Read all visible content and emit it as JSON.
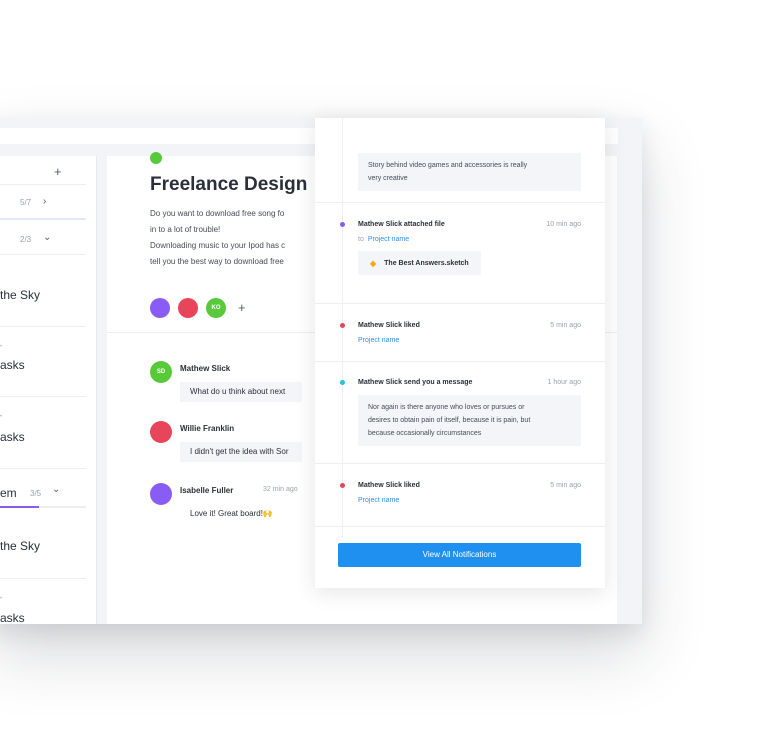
{
  "colors": {
    "accent_blue": "#1f90ef",
    "link_blue": "#2e8ff0",
    "purple": "#8a5cf6",
    "green": "#58c93a",
    "red": "#e8445a",
    "cyan": "#21c3d9"
  },
  "sidebar": {
    "add_icon": "plus-icon",
    "rows": [
      {
        "count": "5/7",
        "chevron": "chevron-right-icon"
      },
      {
        "count": "2/3",
        "chevron": "chevron-down-icon"
      }
    ],
    "items": [
      {
        "title": "the Sky"
      },
      {
        "title": "asks"
      },
      {
        "title": "asks"
      },
      {
        "title": "em",
        "count": "3/5",
        "chevron": "chevron-down-icon",
        "progress": 0.45
      },
      {
        "title": "the Sky"
      },
      {
        "title": "asks"
      }
    ]
  },
  "main": {
    "title": "Freelance Design",
    "description": [
      "Do you want to download free song fo",
      "in to a lot of trouble!",
      "Downloading music to your Ipod has c",
      "tell you the best way to download free"
    ],
    "avatars": [
      {
        "initials": "",
        "color": "#8a5cf6"
      },
      {
        "initials": "",
        "color": "#e8445a"
      },
      {
        "initials": "KO",
        "color": "#58c93a"
      }
    ],
    "messages": [
      {
        "name": "Mathew Slick",
        "time": "",
        "text": "What do u think about next",
        "initials": "SD",
        "color": "#58c93a"
      },
      {
        "name": "Willie Franklin",
        "time": "",
        "text": "I didn't get the idea with Sor",
        "initials": "",
        "color": "#e8445a"
      },
      {
        "name": "Isabelle Fuller",
        "time": "32 min ago",
        "text": "Love it! Great board!🙌",
        "initials": "",
        "color": "#8a5cf6"
      }
    ]
  },
  "notifications": {
    "top_box": [
      "Story behind video games and accessories is really",
      "very creative"
    ],
    "items": [
      {
        "title": "Mathew Slick attached file",
        "time": "10 min ago",
        "to": "to",
        "link": "Project name",
        "file": "The Best Answers.sketch",
        "dot": "#8a5cf6"
      },
      {
        "title": "Mathew Slick liked",
        "time": "5 min ago",
        "link": "Project name",
        "dot": "#e8445a"
      },
      {
        "title": "Mathew Slick send you a message",
        "time": "1 hour ago",
        "box": [
          "Nor again is there anyone who loves or pursues or",
          "desires to obtain pain of itself, because it is pain, but",
          "because occasionally circumstances"
        ],
        "dot": "#21c3d9"
      },
      {
        "title": "Mathew Slick liked",
        "time": "5 min ago",
        "link": "Project name",
        "dot": "#e8445a"
      }
    ],
    "view_all": "View All Notifications"
  }
}
